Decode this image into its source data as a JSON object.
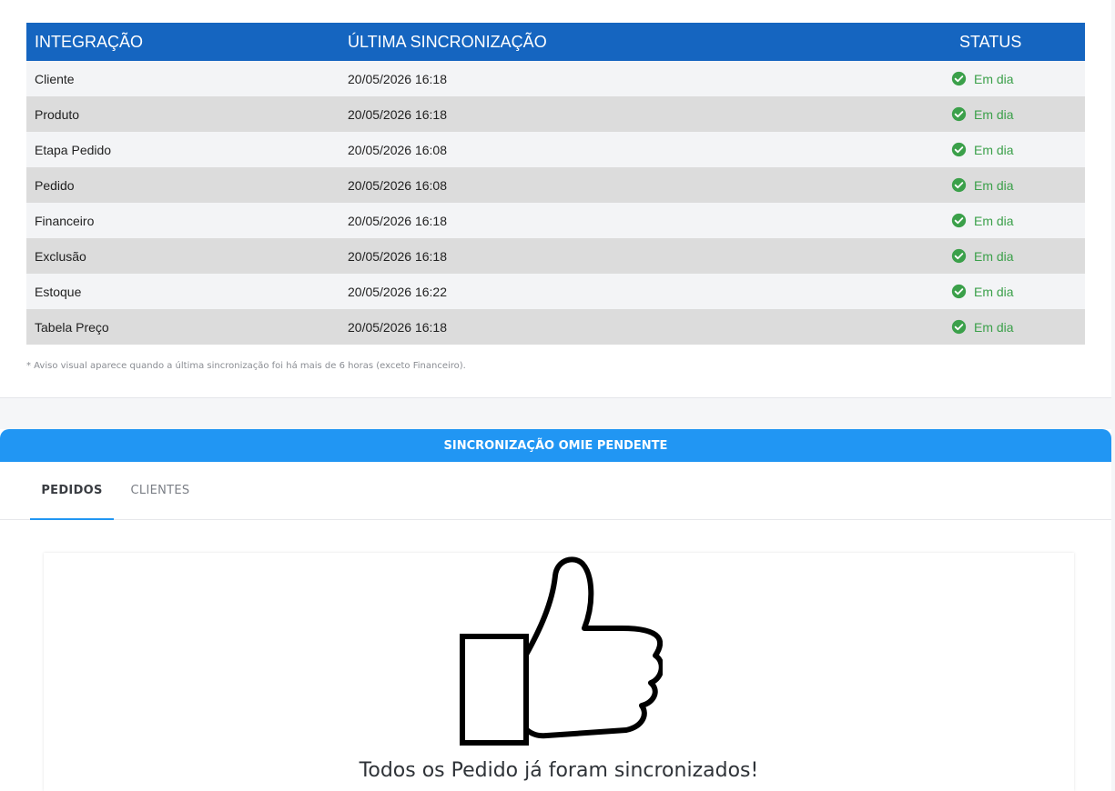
{
  "table": {
    "headers": {
      "integration": "INTEGRAÇÃO",
      "last_sync": "ÚLTIMA SINCRONIZAÇÃO",
      "status": "STATUS"
    },
    "rows": [
      {
        "name": "Cliente",
        "date": "20/05/2026 16:18",
        "status": "Em dia"
      },
      {
        "name": "Produto",
        "date": "20/05/2026 16:18",
        "status": "Em dia"
      },
      {
        "name": "Etapa Pedido",
        "date": "20/05/2026 16:08",
        "status": "Em dia"
      },
      {
        "name": "Pedido",
        "date": "20/05/2026 16:08",
        "status": "Em dia"
      },
      {
        "name": "Financeiro",
        "date": "20/05/2026 16:18",
        "status": "Em dia"
      },
      {
        "name": "Exclusão",
        "date": "20/05/2026 16:18",
        "status": "Em dia"
      },
      {
        "name": "Estoque",
        "date": "20/05/2026 16:22",
        "status": "Em dia"
      },
      {
        "name": "Tabela Preço",
        "date": "20/05/2026 16:18",
        "status": "Em dia"
      }
    ],
    "status_icon": "check-circle-icon",
    "footnote": "* Aviso visual aparece quando a última sincronização foi há mais de 6 horas (exceto Financeiro)."
  },
  "pending": {
    "title": "SINCRONIZAÇÃO OMIE PENDENTE",
    "tabs": [
      {
        "label": "PEDIDOS",
        "active": true
      },
      {
        "label": "CLIENTES",
        "active": false
      }
    ],
    "empty_icon": "thumbs-up-icon",
    "empty_message": "Todos os Pedido já foram sincronizados!"
  },
  "colors": {
    "header_bg": "#1565c0",
    "accent": "#2196f3",
    "status_ok": "#3ba04a"
  }
}
